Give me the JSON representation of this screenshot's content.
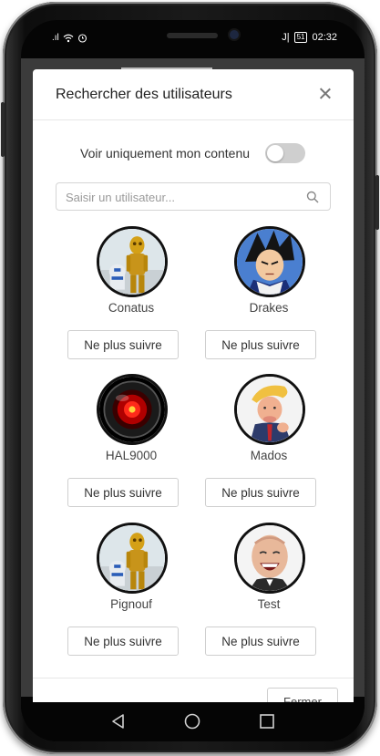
{
  "status_bar": {
    "signal_text": ".ıl",
    "time": "02:32",
    "battery": "51",
    "sim_text": "J|"
  },
  "modal": {
    "title": "Rechercher des utilisateurs",
    "toggle_label": "Voir uniquement mon contenu",
    "toggle_on": false,
    "search_placeholder": "Saisir un utilisateur...",
    "search_value": "",
    "footer_button": "Fermer"
  },
  "users": [
    {
      "name": "Conatus",
      "button": "Ne plus suivre",
      "avatar": "c3po-avatar"
    },
    {
      "name": "Drakes",
      "button": "Ne plus suivre",
      "avatar": "anime-warrior-avatar"
    },
    {
      "name": "HAL9000",
      "button": "Ne plus suivre",
      "avatar": "hal9000-eye-avatar"
    },
    {
      "name": "Mados",
      "button": "Ne plus suivre",
      "avatar": "cartoon-man-avatar"
    },
    {
      "name": "Pignouf",
      "button": "Ne plus suivre",
      "avatar": "c3po-avatar"
    },
    {
      "name": "Test",
      "button": "Ne plus suivre",
      "avatar": "laughing-man-avatar"
    }
  ],
  "navbar": {
    "icons": [
      "back-icon",
      "home-icon",
      "recent-apps-icon"
    ]
  },
  "colors": {
    "modal_bg": "#ffffff",
    "border": "#cfcfcf",
    "toggle_off": "#cfcfcf"
  }
}
